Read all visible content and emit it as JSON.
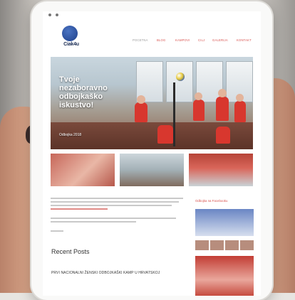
{
  "site": {
    "logo_text": "Ciak4u"
  },
  "nav": {
    "items": [
      "POCETNA",
      "BLOG",
      "KAMPOVI",
      "CILJ",
      "GALERIJA",
      "KONTAKT"
    ]
  },
  "hero": {
    "title_line1": "Tvoje",
    "title_line2": "nezaboravno",
    "title_line3": "odbojkaško",
    "title_line4": "iskustvo!",
    "date": "Odbojka 2018"
  },
  "content": {
    "recent_posts_heading": "Recent Posts",
    "post_date": "",
    "post_title": "PRVI NACIONALNI ŽENSKI ODBOJKAŠKI KAMP U HRVATSKOJ",
    "sidebar_heading": "Odbojka na Facebooku"
  }
}
